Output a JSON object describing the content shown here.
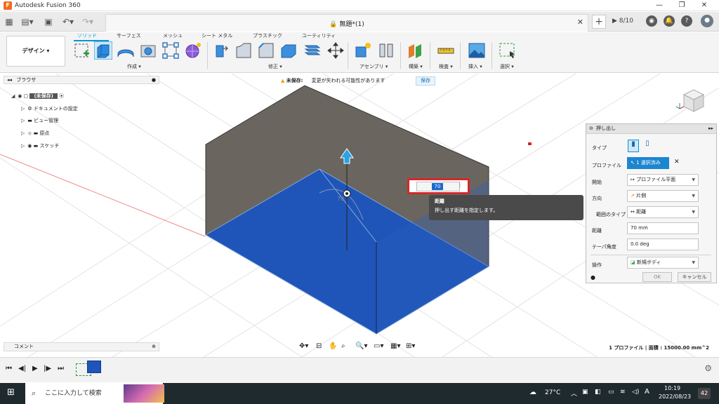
{
  "window": {
    "title": "Autodesk Fusion 360",
    "logo": "F"
  },
  "tab": {
    "name": "無題*(1)",
    "jobs": "8/10",
    "notifications": "0"
  },
  "workspace": {
    "label": "デザイン ▾"
  },
  "toolbar": {
    "tabs": [
      "ソリッド",
      "サーフェス",
      "メッシュ",
      "シート メタル",
      "プラスチック",
      "ユーティリティ"
    ],
    "groups": [
      "作成 ▾",
      "修正 ▾",
      "アセンブリ ▾",
      "構築 ▾",
      "検査 ▾",
      "挿入 ▾",
      "選択 ▾"
    ]
  },
  "browser": {
    "title": "ブラウザ",
    "items": [
      "(未保存)",
      "ドキュメントの設定",
      "ビュー管理",
      "原点",
      "スケッチ"
    ]
  },
  "warning": {
    "label": "未保存:",
    "message": "変更が失われる可能性があります",
    "save": "保存"
  },
  "dimension": {
    "value": "70",
    "ghost": "70"
  },
  "tooltip": {
    "title": "距離",
    "body": "押し出す距離を指定します。"
  },
  "extrude_panel": {
    "title": "押し出し",
    "rows": {
      "type": "タイプ",
      "profile": "プロファイル",
      "profile_value": "1 選択済み",
      "start": "開始",
      "start_value": "プロファイル平面",
      "direction": "方向",
      "direction_value": "片側",
      "extent_type": "範囲のタイプ",
      "extent_value": "距離",
      "distance": "距離",
      "distance_value": "70 mm",
      "taper": "テーパ角度",
      "taper_value": "0.0 deg",
      "operation": "操作",
      "operation_value": "新規ボディ"
    },
    "ok": "OK",
    "cancel": "キャンセル"
  },
  "comments": {
    "label": "コメント"
  },
  "status": {
    "text": "1 プロファイル | 面積 : 15000.00 mm^2"
  },
  "taskbar": {
    "search_placeholder": "ここに入力して検索",
    "weather": "27°C",
    "ime": "A",
    "time": "10:19",
    "date": "2022/08/23",
    "badge": "42"
  },
  "colors": {
    "accent": "#0696d7",
    "body_face": "#1f55b8",
    "box": "#6a665f",
    "highlight": "#d32929"
  }
}
